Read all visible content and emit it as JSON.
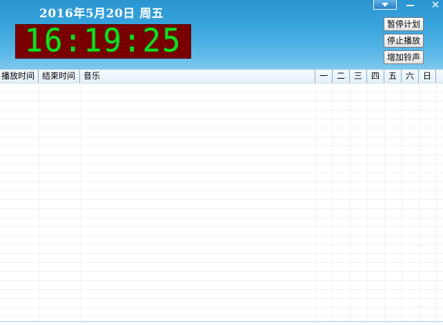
{
  "header": {
    "date_text": "2016年5月20日  周五",
    "clock_text": "16:19:25"
  },
  "window_controls": {
    "menu_icon": "dropdown-triangle-icon",
    "minimize_icon": "minimize-icon",
    "close_label": "✕"
  },
  "actions": {
    "pause_plan": "暂停计划",
    "stop_play": "停止播放",
    "add_bell": "增加铃声"
  },
  "table": {
    "columns": {
      "start_time": "播放时间",
      "end_time": "结束时间",
      "music": "音乐",
      "mon": "一",
      "tue": "二",
      "wed": "三",
      "thu": "四",
      "fri": "五",
      "sat": "六",
      "sun": "日"
    }
  }
}
